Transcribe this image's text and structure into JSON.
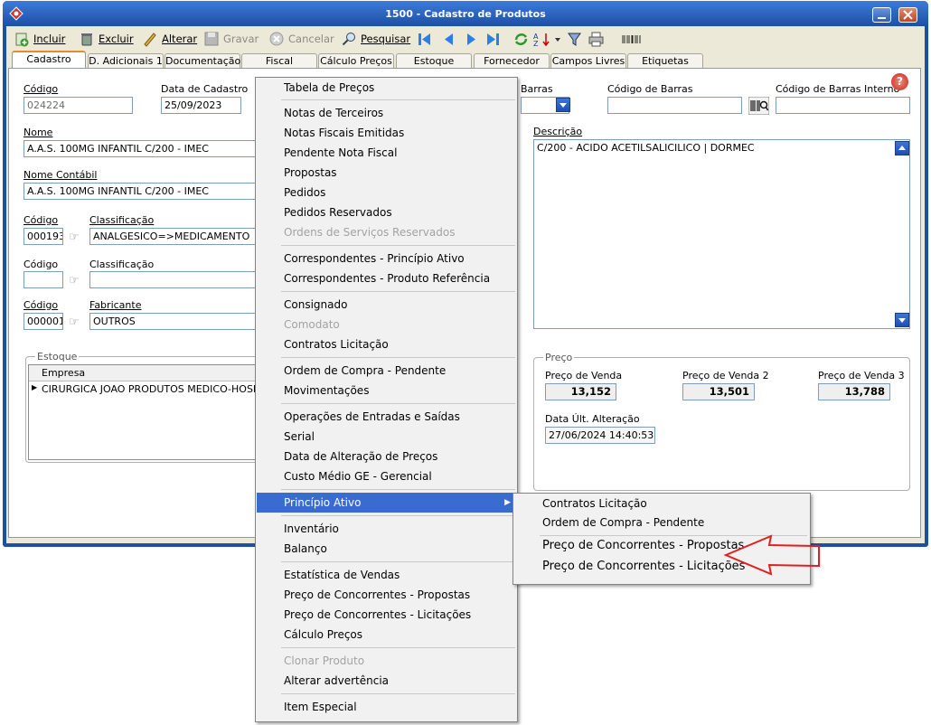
{
  "window": {
    "title": "1500 - Cadastro de Produtos"
  },
  "toolbar": {
    "incluir": "Incluir",
    "excluir": "Excluir",
    "alterar": "Alterar",
    "gravar": "Gravar",
    "cancelar": "Cancelar",
    "pesquisar": "Pesquisar"
  },
  "tabs": [
    "Cadastro",
    "D. Adicionais 1",
    "Documentação",
    "Fiscal",
    "Cálculo Preços",
    "Estoque",
    "Fornecedor",
    "Campos Livres",
    "Etiquetas"
  ],
  "form": {
    "codigo_label": "Código",
    "codigo_value": "024224",
    "data_cadastro_label": "Data de Cadastro",
    "data_cadastro_value": "25/09/2023",
    "barras_label": "Barras",
    "codigo_barras_label": "Código de Barras",
    "codigo_barras_value": "",
    "codigo_barras_interno_label": "Código de Barras Interno",
    "codigo_barras_interno_value": "",
    "nome_label": "Nome",
    "nome_value": "A.A.S. 100MG INFANTIL C/200 - IMEC",
    "nome_contabil_label": "Nome Contábil",
    "nome_contabil_value": "A.A.S. 100MG INFANTIL C/200 - IMEC",
    "descricao_label": "Descrição",
    "descricao_value": "C/200 - ACIDO ACETILSALICILICO | DORMEC",
    "cod1_label": "Código",
    "cod1_value": "000193",
    "class1_label": "Classificação",
    "class1_value": "ANALGESICO=>MEDICAMENTO",
    "cod2_label": "Código",
    "cod2_value": "",
    "class2_label": "Classificação",
    "class2_value": "",
    "cod3_label": "Código",
    "cod3_value": "000001",
    "fabricante_label": "Fabricante",
    "fabricante_value": "OUTROS"
  },
  "estoque": {
    "title": "Estoque",
    "col_empresa": "Empresa",
    "rows": [
      "CIRURGICA JOAO PRODUTOS MEDICO-HOSPIT"
    ]
  },
  "preco": {
    "title": "Preço",
    "venda_label": "Preço de Venda",
    "venda_value": "13,152",
    "venda2_label": "Preço de Venda 2",
    "venda2_value": "13,501",
    "venda3_label": "Preço de Venda 3",
    "venda3_value": "13,788",
    "data_alt_label": "Data Últ. Alteração",
    "data_alt_value": "27/06/2024 14:40:53"
  },
  "menu": {
    "items": [
      "Tabela de Preços",
      "Notas de Terceiros",
      "Notas Fiscais Emitidas",
      "Pendente Nota Fiscal",
      "Propostas",
      "Pedidos",
      "Pedidos Reservados",
      "Ordens de Serviços Reservados",
      "Correspondentes - Princípio Ativo",
      "Correspondentes - Produto Referência",
      "Consignado",
      "Comodato",
      "Contratos Licitação",
      "Ordem de Compra - Pendente",
      "Movimentações",
      "Operações de Entradas e Saídas",
      "Serial",
      "Data de Alteração de Preços",
      "Custo Médio GE - Gerencial",
      "Princípio Ativo",
      "Inventário",
      "Balanço",
      "Estatística de Vendas",
      "Preço de Concorrentes - Propostas",
      "Preço de Concorrentes - Licitações",
      "Cálculo Preços",
      "Clonar Produto",
      "Alterar advertência",
      "Item Especial"
    ]
  },
  "submenu": {
    "items": [
      "Contratos Licitação",
      "Ordem de Compra - Pendente",
      "Preço de Concorrentes - Propostas",
      "Preço de Concorrentes - Licitações"
    ]
  },
  "colors": {
    "titlebar": "#1d4fa8",
    "highlight": "#3a6bd0",
    "annotation_arrow": "#e02020"
  }
}
